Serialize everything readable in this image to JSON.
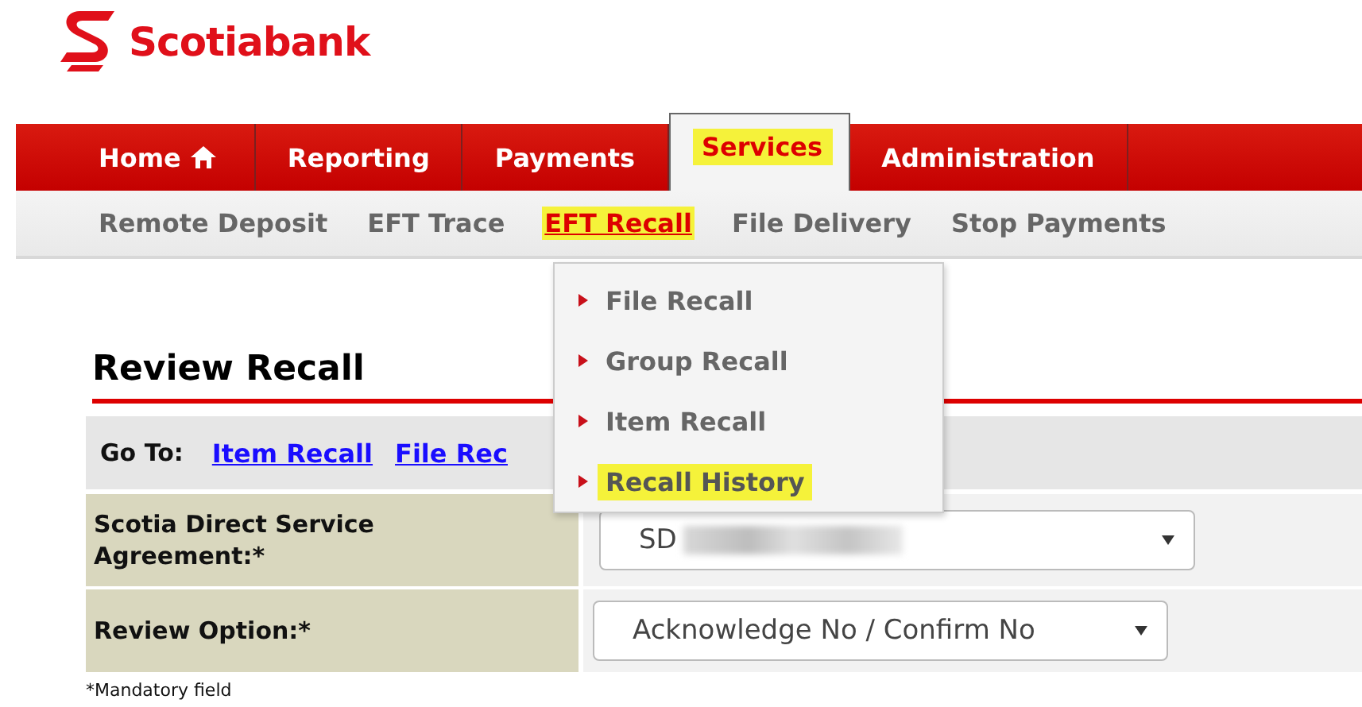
{
  "logo": {
    "text": "Scotiabank"
  },
  "tabs": [
    {
      "label": "Home",
      "kind": "home",
      "selected": false,
      "highlighted": false
    },
    {
      "label": "Reporting",
      "kind": "plain",
      "selected": false,
      "highlighted": false
    },
    {
      "label": "Payments",
      "kind": "plain",
      "selected": false,
      "highlighted": false
    },
    {
      "label": "Services",
      "kind": "plain",
      "selected": true,
      "highlighted": true
    },
    {
      "label": "Administration",
      "kind": "plain",
      "selected": false,
      "highlighted": false
    }
  ],
  "subnav": [
    {
      "label": "Remote Deposit",
      "selected": false,
      "highlighted": false
    },
    {
      "label": "EFT Trace",
      "selected": false,
      "highlighted": false
    },
    {
      "label": "EFT Recall",
      "selected": true,
      "highlighted": true
    },
    {
      "label": "File Delivery",
      "selected": false,
      "highlighted": false
    },
    {
      "label": "Stop Payments",
      "selected": false,
      "highlighted": false
    }
  ],
  "menu": [
    {
      "label": "File Recall",
      "highlighted": false
    },
    {
      "label": "Group Recall",
      "highlighted": false
    },
    {
      "label": "Item Recall",
      "highlighted": false
    },
    {
      "label": "Recall History",
      "highlighted": true
    }
  ],
  "heading": "Review Recall",
  "goto": {
    "label": "Go To:",
    "links": [
      "Item Recall",
      "File Rec"
    ]
  },
  "fields": [
    {
      "label": "Scotia Direct Service Agreement:*",
      "value": "SD",
      "redacted": true
    },
    {
      "label": "Review Option:*",
      "value": "Acknowledge No / Confirm No",
      "redacted": false
    }
  ],
  "footnote": "*Mandatory field"
}
